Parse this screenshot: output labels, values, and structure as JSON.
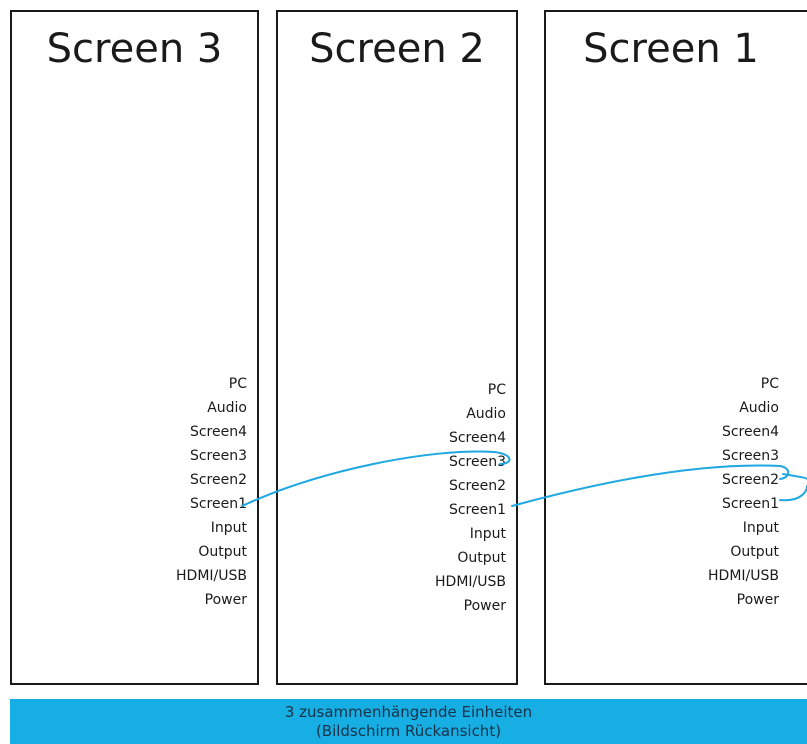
{
  "screens": [
    {
      "title": "Screen 3",
      "ports": [
        "PC",
        "Audio",
        "Screen4",
        "Screen3",
        "Screen2",
        "Screen1",
        "Input",
        "Output",
        "HDMI/USB",
        "Power"
      ]
    },
    {
      "title": "Screen 2",
      "ports": [
        "PC",
        "Audio",
        "Screen4",
        "Screen3",
        "Screen2",
        "Screen1",
        "Input",
        "Output",
        "HDMI/USB",
        "Power"
      ]
    },
    {
      "title": "Screen 1",
      "ports": [
        "PC",
        "Audio",
        "Screen4",
        "Screen3",
        "Screen2",
        "Screen1",
        "Input",
        "Output",
        "HDMI/USB",
        "Power"
      ]
    }
  ],
  "caption": {
    "line1": "3 zusammenhängende Einheiten",
    "line2": "(Bildschirm Rückansicht)"
  },
  "colors": {
    "cable": "#1fa7e1",
    "caption_background": "#17aee3",
    "frame": "#1a1a1a"
  }
}
